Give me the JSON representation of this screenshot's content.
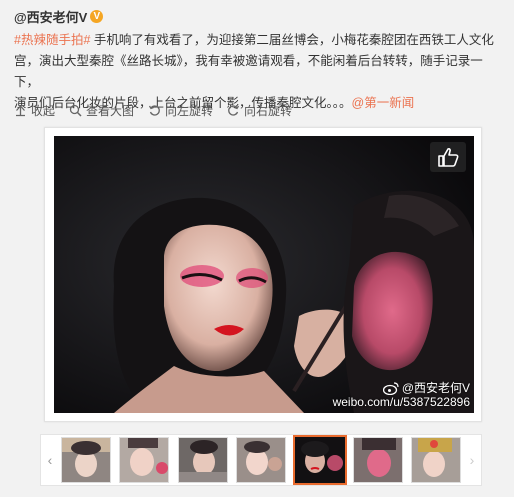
{
  "post": {
    "author": "@西安老何V",
    "verified_badge": "V",
    "hashtag": "#热辣随手拍#",
    "line1": " 手机响了有戏看了，为迎接第二届丝博会，小梅花秦腔团在西铁工人文化",
    "line2": "宫，演出大型秦腔《丝路长城》，我有幸被邀请观看，不能闲着后台转转，随手记录一下，",
    "line3": "演员们后台化妆的片段，上台之前留个影，传播秦腔文化。。。",
    "mention": "@第一新闻"
  },
  "actions": [
    {
      "label": "收起",
      "icon": "collapse-icon"
    },
    {
      "label": "查看大图",
      "icon": "magnify-icon"
    },
    {
      "label": "向左旋转",
      "icon": "rotate-left-icon"
    },
    {
      "label": "向右旋转",
      "icon": "rotate-right-icon"
    }
  ],
  "photo": {
    "watermark_name": "@西安老何V",
    "watermark_url": "weibo.com/u/5387522896"
  },
  "colors": {
    "link": "#eb7350",
    "selected_thumb_border": "#e96b2e",
    "verified": "#f5a623"
  }
}
